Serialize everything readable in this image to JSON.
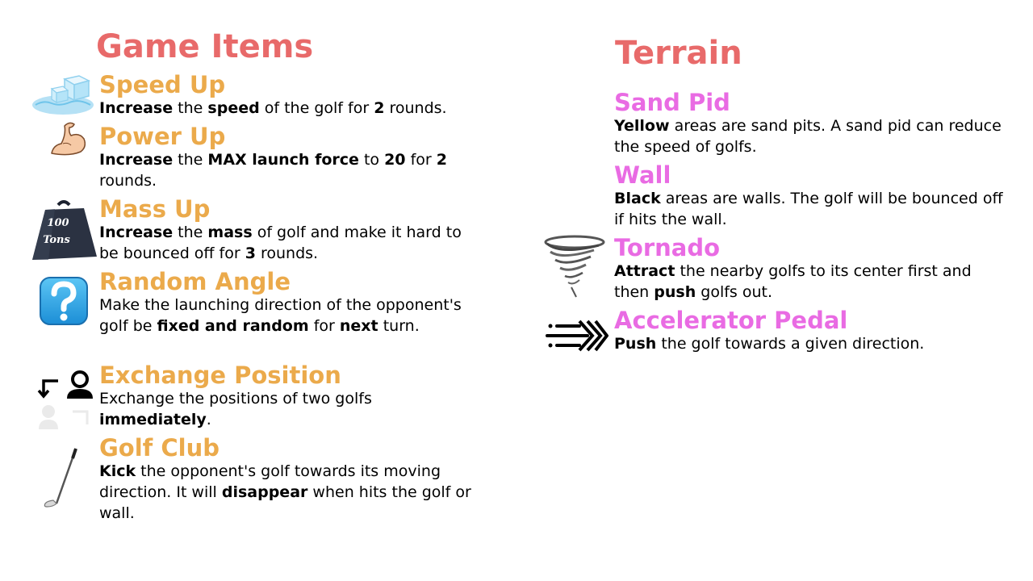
{
  "game_items": {
    "title": "Game Items",
    "items": [
      {
        "name": "Speed Up",
        "icon": "ice-cube-icon",
        "desc": [
          {
            "t": "Increase",
            "b": true
          },
          {
            "t": " the "
          },
          {
            "t": "speed",
            "b": true
          },
          {
            "t": " of the golf for "
          },
          {
            "t": "2",
            "b": true
          },
          {
            "t": " rounds."
          }
        ]
      },
      {
        "name": "Power Up",
        "icon": "flexed-arm-icon",
        "desc": [
          {
            "t": "Increase",
            "b": true
          },
          {
            "t": " the "
          },
          {
            "t": "MAX launch force",
            "b": true
          },
          {
            "t": " to "
          },
          {
            "t": "20",
            "b": true
          },
          {
            "t": " for "
          },
          {
            "t": "2",
            "b": true
          },
          {
            "t": " rounds."
          }
        ]
      },
      {
        "name": "Mass Up",
        "icon": "weight-icon",
        "icon_text": [
          "100",
          "Tons"
        ],
        "desc": [
          {
            "t": "Increase",
            "b": true
          },
          {
            "t": " the "
          },
          {
            "t": "mass",
            "b": true
          },
          {
            "t": " of golf and make it hard to be bounced off for "
          },
          {
            "t": "3",
            "b": true
          },
          {
            "t": " rounds."
          }
        ]
      },
      {
        "name": "Random Angle",
        "icon": "question-mark-icon",
        "desc": [
          {
            "t": "Make the launching direction of the opponent's golf be "
          },
          {
            "t": "fixed and random",
            "b": true
          },
          {
            "t": " for "
          },
          {
            "t": "next",
            "b": true
          },
          {
            "t": " turn."
          }
        ]
      },
      {
        "name": "Exchange Position",
        "icon": "exchange-person-icon",
        "desc": [
          {
            "t": "Exchange the positions of two golfs "
          },
          {
            "t": "immediately",
            "b": true
          },
          {
            "t": "."
          }
        ]
      },
      {
        "name": "Golf Club",
        "icon": "golf-club-icon",
        "desc": [
          {
            "t": "Kick",
            "b": true
          },
          {
            "t": " the opponent's golf towards its moving direction. It will "
          },
          {
            "t": "disappear",
            "b": true
          },
          {
            "t": " when hits the golf or wall."
          }
        ]
      }
    ]
  },
  "terrain": {
    "title": "Terrain",
    "items": [
      {
        "name": "Sand Pid",
        "icon": null,
        "desc": [
          {
            "t": "Yellow",
            "b": true
          },
          {
            "t": " areas are sand pits. A sand pid can reduce the speed of golfs."
          }
        ]
      },
      {
        "name": "Wall",
        "icon": null,
        "desc": [
          {
            "t": "Black",
            "b": true
          },
          {
            "t": " areas are walls. The golf will be bounced off if hits the wall."
          }
        ]
      },
      {
        "name": "Tornado",
        "icon": "tornado-icon",
        "desc": [
          {
            "t": "Attract",
            "b": true
          },
          {
            "t": " the nearby golfs to its center first and then "
          },
          {
            "t": "push",
            "b": true
          },
          {
            "t": " golfs out."
          }
        ]
      },
      {
        "name": "Accelerator Pedal",
        "icon": "speed-arrows-icon",
        "desc": [
          {
            "t": "Push",
            "b": true
          },
          {
            "t": " the golf towards a given direction."
          }
        ]
      }
    ]
  },
  "colors": {
    "section_title": "#e86a6a",
    "item_title": "#ebaa4b",
    "terrain_title": "#e96be3"
  }
}
